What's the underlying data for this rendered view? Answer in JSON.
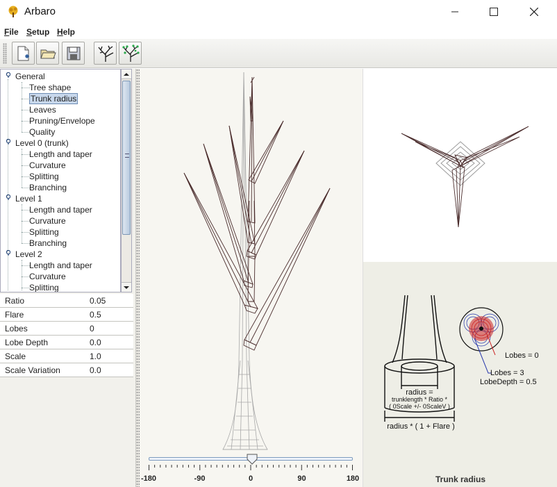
{
  "window": {
    "title": "Arbaro"
  },
  "menu": [
    "File",
    "Setup",
    "Help"
  ],
  "toolbar": {
    "buttons": [
      {
        "name": "new-document-icon"
      },
      {
        "name": "open-folder-icon"
      },
      {
        "name": "save-disk-icon"
      },
      {
        "name": "render-tree-icon"
      },
      {
        "name": "render-leaves-icon"
      }
    ]
  },
  "tree": {
    "nodes": [
      {
        "label": "General",
        "level": 0
      },
      {
        "label": "Tree shape",
        "level": 1
      },
      {
        "label": "Trunk radius",
        "level": 1,
        "selected": true
      },
      {
        "label": "Leaves",
        "level": 1
      },
      {
        "label": "Pruning/Envelope",
        "level": 1
      },
      {
        "label": "Quality",
        "level": 1
      },
      {
        "label": "Level 0 (trunk)",
        "level": 0
      },
      {
        "label": "Length and taper",
        "level": 1
      },
      {
        "label": "Curvature",
        "level": 1
      },
      {
        "label": "Splitting",
        "level": 1
      },
      {
        "label": "Branching",
        "level": 1
      },
      {
        "label": "Level 1",
        "level": 0
      },
      {
        "label": "Length and taper",
        "level": 1
      },
      {
        "label": "Curvature",
        "level": 1
      },
      {
        "label": "Splitting",
        "level": 1
      },
      {
        "label": "Branching",
        "level": 1
      },
      {
        "label": "Level 2",
        "level": 0
      },
      {
        "label": "Length and taper",
        "level": 1
      },
      {
        "label": "Curvature",
        "level": 1
      },
      {
        "label": "Splitting",
        "level": 1
      }
    ]
  },
  "params": [
    {
      "name": "Ratio",
      "value": "0.05"
    },
    {
      "name": "Flare",
      "value": "0.5"
    },
    {
      "name": "Lobes",
      "value": "0"
    },
    {
      "name": "Lobe Depth",
      "value": "0.0"
    },
    {
      "name": "Scale",
      "value": "1.0"
    },
    {
      "name": "Scale Variation",
      "value": "0.0"
    }
  ],
  "slider": {
    "value": 0,
    "min": -180,
    "max": 180,
    "labels": [
      "-180",
      "-90",
      "0",
      "90",
      "180"
    ]
  },
  "help": {
    "caption": "Trunk radius",
    "lobes0": "Lobes = 0",
    "lobes3": "Lobes = 3",
    "lobedepth": "LobeDepth = 0.5",
    "radius_line1": "radius =",
    "radius_line2": "trunklength * Ratio *",
    "radius_line3": "( 0Scale +/- 0ScaleV )",
    "flare": "radius * ( 1 + Flare )"
  },
  "colors": {
    "branch_stroke": "#4a2c2c",
    "trunk_stroke": "#9a9a9a",
    "selection": "#c8d8ec",
    "lobe_red": "#cc2222",
    "lobe_blue": "#2233aa"
  }
}
